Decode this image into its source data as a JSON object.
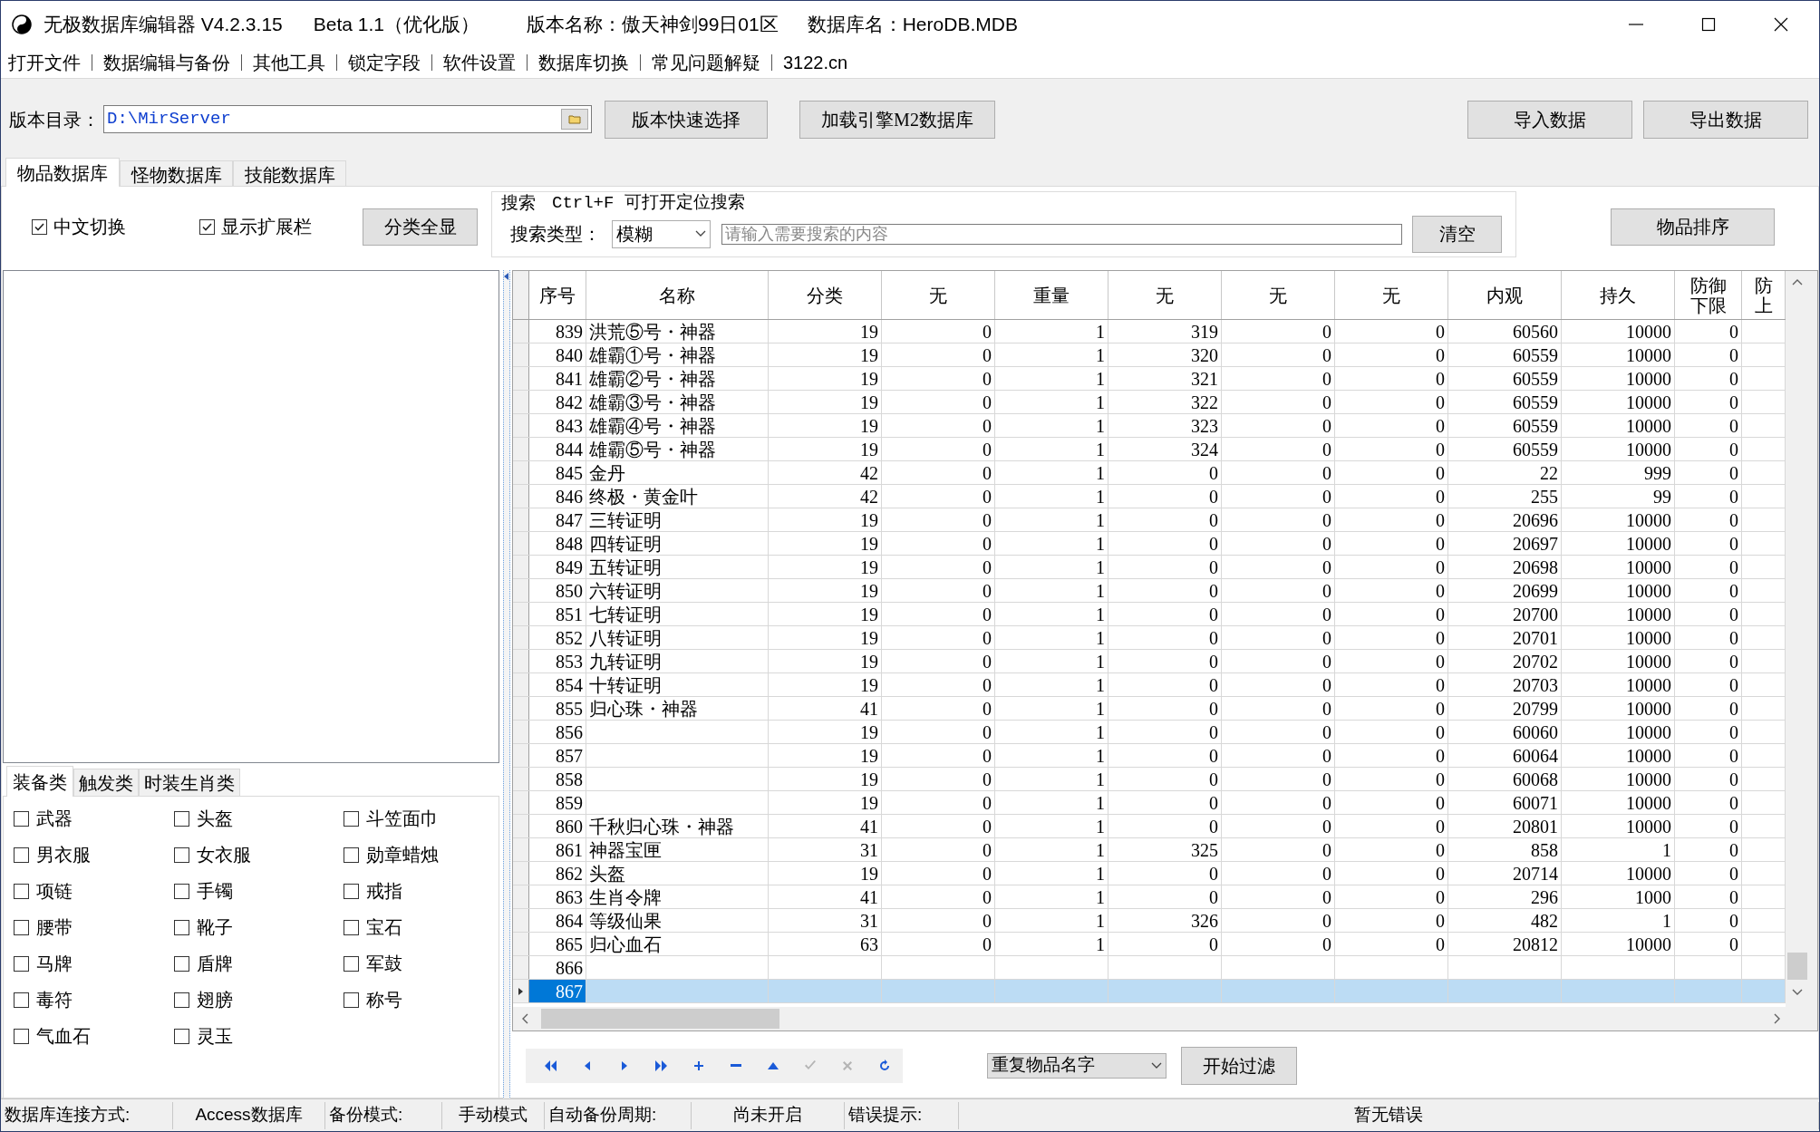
{
  "window": {
    "title": "无极数据库编辑器 V4.2.3.15",
    "edition": "Beta 1.1（优化版）",
    "version_name": "版本名称：傲天神剑99日01区",
    "database_name": "数据库名：HeroDB.MDB"
  },
  "menu": [
    "打开文件",
    "数据编辑与备份",
    "其他工具",
    "锁定字段",
    "软件设置",
    "数据库切换",
    "常见问题解疑",
    "3122.cn"
  ],
  "toolbar": {
    "dir_label": "版本目录：",
    "dir_value": "D:\\MirServer",
    "buttons_left": [
      "版本快速选择",
      "加载引擎M2数据库"
    ],
    "buttons_right": [
      "导入数据",
      "导出数据"
    ]
  },
  "tabs": [
    {
      "label": "物品数据库",
      "selected": true
    },
    {
      "label": "怪物数据库",
      "selected": false
    },
    {
      "label": "技能数据库",
      "selected": false
    }
  ],
  "options": {
    "checkboxes": [
      {
        "label": "中文切换",
        "checked": true
      },
      {
        "label": "显示扩展栏",
        "checked": true
      }
    ],
    "show_all_button": "分类全显"
  },
  "search": {
    "title": "搜索",
    "hint": "Ctrl+F 可打开定位搜索",
    "type_label": "搜索类型：",
    "type_value": "模糊",
    "placeholder": "请输入需要搜索的内容",
    "clear_button": "清空"
  },
  "sort_button": "物品排序",
  "category_tabs": [
    {
      "label": "装备类",
      "selected": true
    },
    {
      "label": "触发类",
      "selected": false
    },
    {
      "label": "时装生肖类",
      "selected": false
    }
  ],
  "categories": [
    {
      "label": "武器",
      "checked": false
    },
    {
      "label": "头盔",
      "checked": false
    },
    {
      "label": "斗笠面巾",
      "checked": false
    },
    {
      "label": "男衣服",
      "checked": false
    },
    {
      "label": "女衣服",
      "checked": false
    },
    {
      "label": "勋章蜡烛",
      "checked": false
    },
    {
      "label": "项链",
      "checked": false
    },
    {
      "label": "手镯",
      "checked": false
    },
    {
      "label": "戒指",
      "checked": false
    },
    {
      "label": "腰带",
      "checked": false
    },
    {
      "label": "靴子",
      "checked": false
    },
    {
      "label": "宝石",
      "checked": false
    },
    {
      "label": "马牌",
      "checked": false
    },
    {
      "label": "盾牌",
      "checked": false
    },
    {
      "label": "军鼓",
      "checked": false
    },
    {
      "label": "毒符",
      "checked": false
    },
    {
      "label": "翅膀",
      "checked": false
    },
    {
      "label": "称号",
      "checked": false
    },
    {
      "label": "气血石",
      "checked": false
    },
    {
      "label": "灵玉",
      "checked": false
    }
  ],
  "grid": {
    "columns": [
      "序号",
      "名称",
      "分类",
      "无",
      "重量",
      "无",
      "无",
      "无",
      "内观",
      "持久",
      "防御下限",
      "防上"
    ],
    "rows": [
      {
        "cells": [
          "839",
          "洪荒⑤号・神器",
          "19",
          "0",
          "1",
          "319",
          "0",
          "0",
          "60560",
          "10000",
          "0"
        ],
        "selected": false
      },
      {
        "cells": [
          "840",
          "雄霸①号・神器",
          "19",
          "0",
          "1",
          "320",
          "0",
          "0",
          "60559",
          "10000",
          "0"
        ],
        "selected": false
      },
      {
        "cells": [
          "841",
          "雄霸②号・神器",
          "19",
          "0",
          "1",
          "321",
          "0",
          "0",
          "60559",
          "10000",
          "0"
        ],
        "selected": false
      },
      {
        "cells": [
          "842",
          "雄霸③号・神器",
          "19",
          "0",
          "1",
          "322",
          "0",
          "0",
          "60559",
          "10000",
          "0"
        ],
        "selected": false
      },
      {
        "cells": [
          "843",
          "雄霸④号・神器",
          "19",
          "0",
          "1",
          "323",
          "0",
          "0",
          "60559",
          "10000",
          "0"
        ],
        "selected": false
      },
      {
        "cells": [
          "844",
          "雄霸⑤号・神器",
          "19",
          "0",
          "1",
          "324",
          "0",
          "0",
          "60559",
          "10000",
          "0"
        ],
        "selected": false
      },
      {
        "cells": [
          "845",
          "金丹",
          "42",
          "0",
          "1",
          "0",
          "0",
          "0",
          "22",
          "999",
          "0"
        ],
        "selected": false
      },
      {
        "cells": [
          "846",
          "终极・黄金叶",
          "42",
          "0",
          "1",
          "0",
          "0",
          "0",
          "255",
          "99",
          "0"
        ],
        "selected": false
      },
      {
        "cells": [
          "847",
          "三转证明",
          "19",
          "0",
          "1",
          "0",
          "0",
          "0",
          "20696",
          "10000",
          "0"
        ],
        "selected": false
      },
      {
        "cells": [
          "848",
          "四转证明",
          "19",
          "0",
          "1",
          "0",
          "0",
          "0",
          "20697",
          "10000",
          "0"
        ],
        "selected": false
      },
      {
        "cells": [
          "849",
          "五转证明",
          "19",
          "0",
          "1",
          "0",
          "0",
          "0",
          "20698",
          "10000",
          "0"
        ],
        "selected": false
      },
      {
        "cells": [
          "850",
          "六转证明",
          "19",
          "0",
          "1",
          "0",
          "0",
          "0",
          "20699",
          "10000",
          "0"
        ],
        "selected": false
      },
      {
        "cells": [
          "851",
          "七转证明",
          "19",
          "0",
          "1",
          "0",
          "0",
          "0",
          "20700",
          "10000",
          "0"
        ],
        "selected": false
      },
      {
        "cells": [
          "852",
          "八转证明",
          "19",
          "0",
          "1",
          "0",
          "0",
          "0",
          "20701",
          "10000",
          "0"
        ],
        "selected": false
      },
      {
        "cells": [
          "853",
          "九转证明",
          "19",
          "0",
          "1",
          "0",
          "0",
          "0",
          "20702",
          "10000",
          "0"
        ],
        "selected": false
      },
      {
        "cells": [
          "854",
          "十转证明",
          "19",
          "0",
          "1",
          "0",
          "0",
          "0",
          "20703",
          "10000",
          "0"
        ],
        "selected": false
      },
      {
        "cells": [
          "855",
          "归心珠・神器",
          "41",
          "0",
          "1",
          "0",
          "0",
          "0",
          "20799",
          "10000",
          "0"
        ],
        "selected": false
      },
      {
        "cells": [
          "856",
          null,
          "19",
          "0",
          "1",
          "0",
          "0",
          "0",
          "60060",
          "10000",
          "0"
        ],
        "selected": false
      },
      {
        "cells": [
          "857",
          null,
          "19",
          "0",
          "1",
          "0",
          "0",
          "0",
          "60064",
          "10000",
          "0"
        ],
        "selected": false
      },
      {
        "cells": [
          "858",
          null,
          "19",
          "0",
          "1",
          "0",
          "0",
          "0",
          "60068",
          "10000",
          "0"
        ],
        "selected": false
      },
      {
        "cells": [
          "859",
          null,
          "19",
          "0",
          "1",
          "0",
          "0",
          "0",
          "60071",
          "10000",
          "0"
        ],
        "selected": false
      },
      {
        "cells": [
          "860",
          "千秋归心珠・神器",
          "41",
          "0",
          "1",
          "0",
          "0",
          "0",
          "20801",
          "10000",
          "0"
        ],
        "selected": false
      },
      {
        "cells": [
          "861",
          "神器宝匣",
          "31",
          "0",
          "1",
          "325",
          "0",
          "0",
          "858",
          "1",
          "0"
        ],
        "selected": false
      },
      {
        "cells": [
          "862",
          "头盔",
          "19",
          "0",
          "1",
          "0",
          "0",
          "0",
          "20714",
          "10000",
          "0"
        ],
        "selected": false
      },
      {
        "cells": [
          "863",
          "生肖令牌",
          "41",
          "0",
          "1",
          "0",
          "0",
          "0",
          "296",
          "1000",
          "0"
        ],
        "selected": false
      },
      {
        "cells": [
          "864",
          "等级仙果",
          "31",
          "0",
          "1",
          "326",
          "0",
          "0",
          "482",
          "1",
          "0"
        ],
        "selected": false
      },
      {
        "cells": [
          "865",
          "归心血石",
          "63",
          "0",
          "1",
          "0",
          "0",
          "0",
          "20812",
          "10000",
          "0"
        ],
        "selected": false
      },
      {
        "cells": [
          "866"
        ],
        "selected": false
      },
      {
        "cells": [
          "867"
        ],
        "selected": true
      }
    ]
  },
  "nav_buttons": [
    {
      "kind": "first",
      "disabled": false
    },
    {
      "kind": "prior",
      "disabled": false
    },
    {
      "kind": "next",
      "disabled": false
    },
    {
      "kind": "last",
      "disabled": false
    },
    {
      "kind": "insert",
      "disabled": false
    },
    {
      "kind": "delete",
      "disabled": false
    },
    {
      "kind": "edit",
      "disabled": false
    },
    {
      "kind": "post",
      "disabled": true
    },
    {
      "kind": "cancel",
      "disabled": true
    },
    {
      "kind": "refresh",
      "disabled": false
    }
  ],
  "filter": {
    "value": "重复物品名字",
    "button": "开始过滤"
  },
  "status_bar": [
    {
      "text": "数据库连接方式:",
      "kind": "label"
    },
    {
      "text": "Access数据库",
      "kind": "value"
    },
    {
      "text": "备份模式:",
      "kind": "label"
    },
    {
      "text": "手动模式",
      "kind": "value"
    },
    {
      "text": "自动备份周期:",
      "kind": "label"
    },
    {
      "text": "尚未开启",
      "kind": "value"
    },
    {
      "text": "错误提示:",
      "kind": "label"
    },
    {
      "text": "暂无错误",
      "kind": "value"
    }
  ]
}
